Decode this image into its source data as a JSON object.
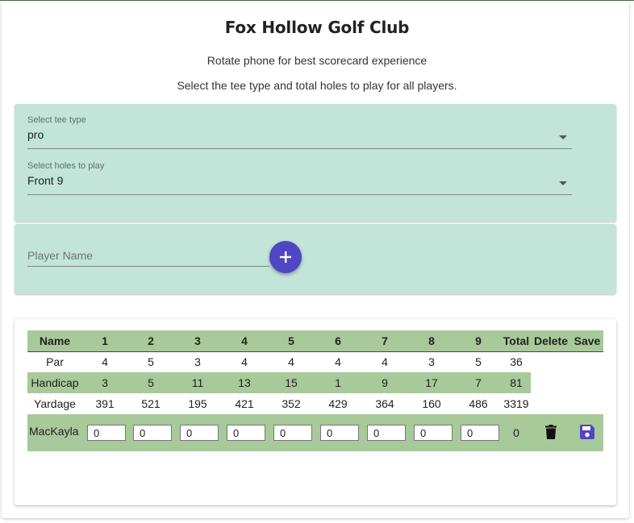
{
  "header": {
    "title": "Fox Hollow Golf Club",
    "rotate_note": "Rotate phone for best scorecard experience",
    "instruction": "Select the tee type and total holes to play for all players."
  },
  "tee_select": {
    "label": "Select tee type",
    "value": "pro"
  },
  "holes_select": {
    "label": "Select holes to play",
    "value": "Front 9"
  },
  "player_input": {
    "placeholder": "Player Name",
    "add_icon": "plus-icon"
  },
  "scorecard": {
    "headers": [
      "Name",
      "1",
      "2",
      "3",
      "4",
      "5",
      "6",
      "7",
      "8",
      "9",
      "Total",
      "Delete",
      "Save"
    ],
    "par": {
      "label": "Par",
      "values": [
        "4",
        "5",
        "3",
        "4",
        "4",
        "4",
        "4",
        "3",
        "5"
      ],
      "total": "36"
    },
    "handicap": {
      "label": "Handicap",
      "values": [
        "3",
        "5",
        "11",
        "13",
        "15",
        "1",
        "9",
        "17",
        "7"
      ],
      "total": "81"
    },
    "yardage": {
      "label": "Yardage",
      "values": [
        "391",
        "521",
        "195",
        "421",
        "352",
        "429",
        "364",
        "160",
        "486"
      ],
      "total": "3319"
    },
    "players": [
      {
        "name": "MacKayla",
        "scores": [
          "0",
          "0",
          "0",
          "0",
          "0",
          "0",
          "0",
          "0",
          "0"
        ],
        "total": "0",
        "delete_icon": "trash-icon",
        "save_icon": "floppy-disk-icon"
      }
    ]
  },
  "colors": {
    "panel": "#c2e4d9",
    "table_green": "#a8c99a",
    "accent": "#4f46c4"
  }
}
